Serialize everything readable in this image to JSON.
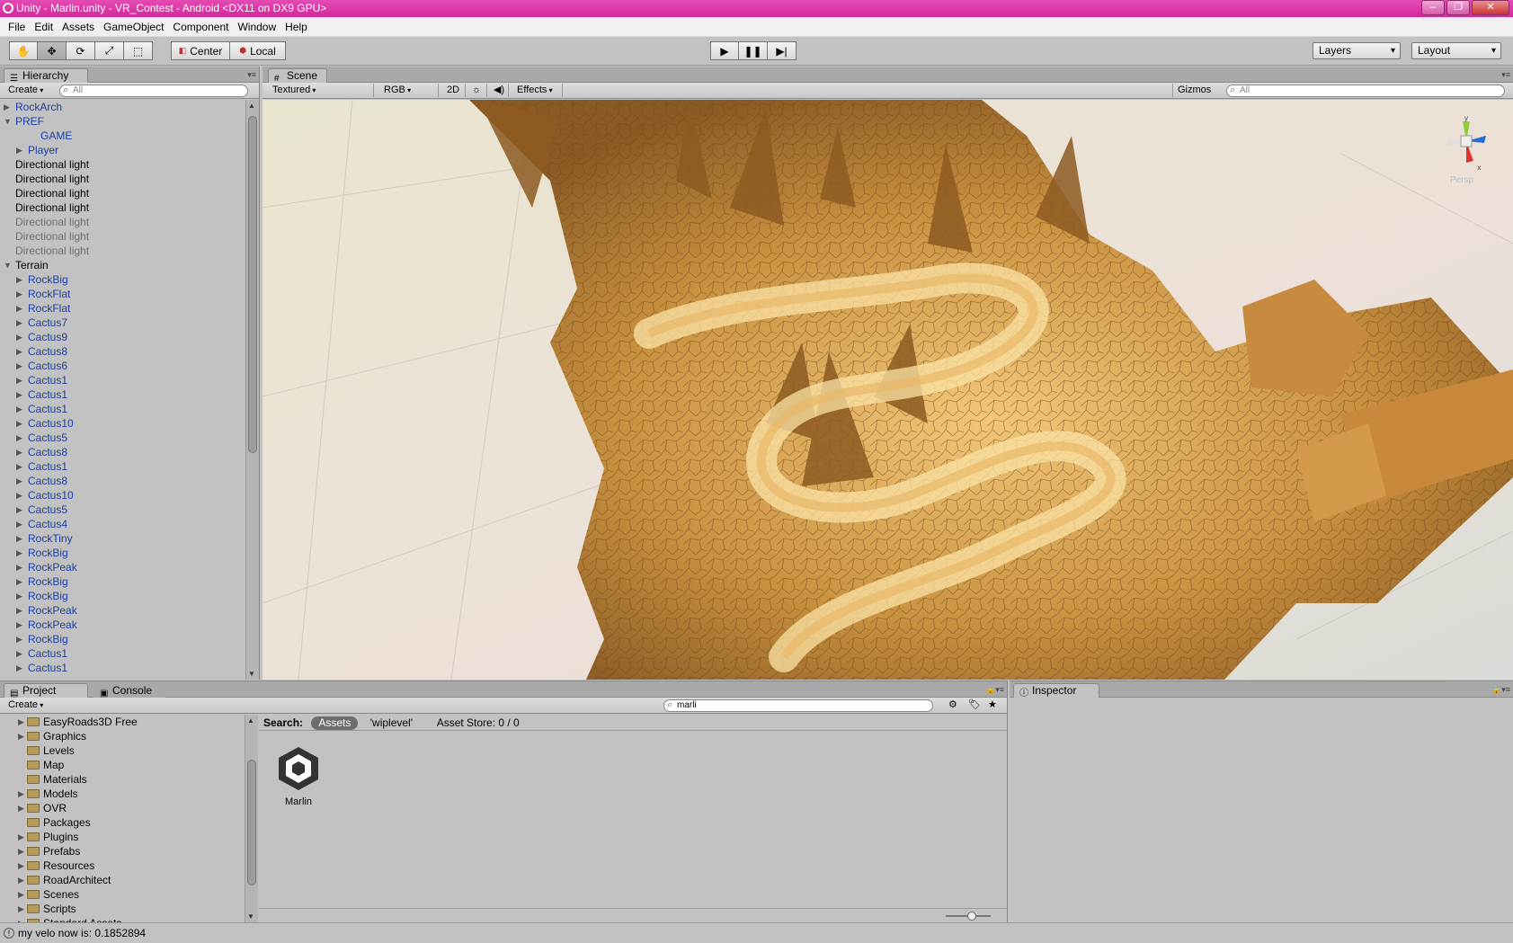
{
  "window": {
    "title": "Unity - Marlin.unity - VR_Contest - Android <DX11 on DX9 GPU>"
  },
  "menu": [
    "File",
    "Edit",
    "Assets",
    "GameObject",
    "Component",
    "Window",
    "Help"
  ],
  "toolbar": {
    "pivot_label": "Center",
    "space_label": "Local",
    "layers_label": "Layers",
    "layout_label": "Layout"
  },
  "hierarchy": {
    "tab_label": "Hierarchy",
    "create_label": "Create",
    "search_placeholder": "All",
    "items": [
      {
        "label": "RockArch",
        "indent": 0,
        "arrow": "▶",
        "style": "prefab"
      },
      {
        "label": "PREF",
        "indent": 0,
        "arrow": "▼",
        "style": "prefab"
      },
      {
        "label": "GAME",
        "indent": 2,
        "arrow": "",
        "style": "prefab"
      },
      {
        "label": "Player",
        "indent": 1,
        "arrow": "▶",
        "style": "prefab"
      },
      {
        "label": "Directional light",
        "indent": 0,
        "arrow": "",
        "style": "normal"
      },
      {
        "label": "Directional light",
        "indent": 0,
        "arrow": "",
        "style": "normal"
      },
      {
        "label": "Directional light",
        "indent": 0,
        "arrow": "",
        "style": "normal"
      },
      {
        "label": "Directional light",
        "indent": 0,
        "arrow": "",
        "style": "normal"
      },
      {
        "label": "Directional light",
        "indent": 0,
        "arrow": "",
        "style": "disabled"
      },
      {
        "label": "Directional light",
        "indent": 0,
        "arrow": "",
        "style": "disabled"
      },
      {
        "label": "Directional light",
        "indent": 0,
        "arrow": "",
        "style": "disabled"
      },
      {
        "label": "Terrain",
        "indent": 0,
        "arrow": "▼",
        "style": "normal"
      },
      {
        "label": "RockBig",
        "indent": 1,
        "arrow": "▶",
        "style": "prefab"
      },
      {
        "label": "RockFlat",
        "indent": 1,
        "arrow": "▶",
        "style": "prefab"
      },
      {
        "label": "RockFlat",
        "indent": 1,
        "arrow": "▶",
        "style": "prefab"
      },
      {
        "label": "Cactus7",
        "indent": 1,
        "arrow": "▶",
        "style": "prefab"
      },
      {
        "label": "Cactus9",
        "indent": 1,
        "arrow": "▶",
        "style": "prefab"
      },
      {
        "label": "Cactus8",
        "indent": 1,
        "arrow": "▶",
        "style": "prefab"
      },
      {
        "label": "Cactus6",
        "indent": 1,
        "arrow": "▶",
        "style": "prefab"
      },
      {
        "label": "Cactus1",
        "indent": 1,
        "arrow": "▶",
        "style": "prefab"
      },
      {
        "label": "Cactus1",
        "indent": 1,
        "arrow": "▶",
        "style": "prefab"
      },
      {
        "label": "Cactus1",
        "indent": 1,
        "arrow": "▶",
        "style": "prefab"
      },
      {
        "label": "Cactus10",
        "indent": 1,
        "arrow": "▶",
        "style": "prefab"
      },
      {
        "label": "Cactus5",
        "indent": 1,
        "arrow": "▶",
        "style": "prefab"
      },
      {
        "label": "Cactus8",
        "indent": 1,
        "arrow": "▶",
        "style": "prefab"
      },
      {
        "label": "Cactus1",
        "indent": 1,
        "arrow": "▶",
        "style": "prefab"
      },
      {
        "label": "Cactus8",
        "indent": 1,
        "arrow": "▶",
        "style": "prefab"
      },
      {
        "label": "Cactus10",
        "indent": 1,
        "arrow": "▶",
        "style": "prefab"
      },
      {
        "label": "Cactus5",
        "indent": 1,
        "arrow": "▶",
        "style": "prefab"
      },
      {
        "label": "Cactus4",
        "indent": 1,
        "arrow": "▶",
        "style": "prefab"
      },
      {
        "label": "RockTiny",
        "indent": 1,
        "arrow": "▶",
        "style": "prefab"
      },
      {
        "label": "RockBig",
        "indent": 1,
        "arrow": "▶",
        "style": "prefab"
      },
      {
        "label": "RockPeak",
        "indent": 1,
        "arrow": "▶",
        "style": "prefab"
      },
      {
        "label": "RockBig",
        "indent": 1,
        "arrow": "▶",
        "style": "prefab"
      },
      {
        "label": "RockBig",
        "indent": 1,
        "arrow": "▶",
        "style": "prefab"
      },
      {
        "label": "RockPeak",
        "indent": 1,
        "arrow": "▶",
        "style": "prefab"
      },
      {
        "label": "RockPeak",
        "indent": 1,
        "arrow": "▶",
        "style": "prefab"
      },
      {
        "label": "RockBig",
        "indent": 1,
        "arrow": "▶",
        "style": "prefab"
      },
      {
        "label": "Cactus1",
        "indent": 1,
        "arrow": "▶",
        "style": "prefab"
      },
      {
        "label": "Cactus1",
        "indent": 1,
        "arrow": "▶",
        "style": "prefab"
      }
    ]
  },
  "scene": {
    "tab_label": "Scene",
    "draw_mode": "Textured",
    "render_mode": "RGB",
    "mode_2d": "2D",
    "effects_label": "Effects",
    "gizmos_label": "Gizmos",
    "search_placeholder": "All",
    "gizmo_persp": "Persp",
    "gizmo_axes": {
      "y": "y",
      "x": "x"
    }
  },
  "project": {
    "tab_label": "Project",
    "console_tab_label": "Console",
    "create_label": "Create",
    "search_value": "marli",
    "search_label": "Search:",
    "scope_assets": "Assets",
    "scope_folder": "'wiplevel'",
    "asset_store": "Asset Store: 0 / 0",
    "folders": [
      {
        "label": "EasyRoads3D Free",
        "arrow": "▶"
      },
      {
        "label": "Graphics",
        "arrow": "▶"
      },
      {
        "label": "Levels",
        "arrow": ""
      },
      {
        "label": "Map",
        "arrow": ""
      },
      {
        "label": "Materials",
        "arrow": ""
      },
      {
        "label": "Models",
        "arrow": "▶"
      },
      {
        "label": "OVR",
        "arrow": "▶"
      },
      {
        "label": "Packages",
        "arrow": ""
      },
      {
        "label": "Plugins",
        "arrow": "▶"
      },
      {
        "label": "Prefabs",
        "arrow": "▶"
      },
      {
        "label": "Resources",
        "arrow": "▶"
      },
      {
        "label": "RoadArchitect",
        "arrow": "▶"
      },
      {
        "label": "Scenes",
        "arrow": "▶"
      },
      {
        "label": "Scripts",
        "arrow": "▶"
      },
      {
        "label": "Standard Assets",
        "arrow": "▶"
      }
    ],
    "results": [
      {
        "label": "Marlin",
        "icon": "unity-logo-icon"
      }
    ]
  },
  "inspector": {
    "tab_label": "Inspector"
  },
  "status": {
    "message": "my velo now is: 0.1852894"
  }
}
